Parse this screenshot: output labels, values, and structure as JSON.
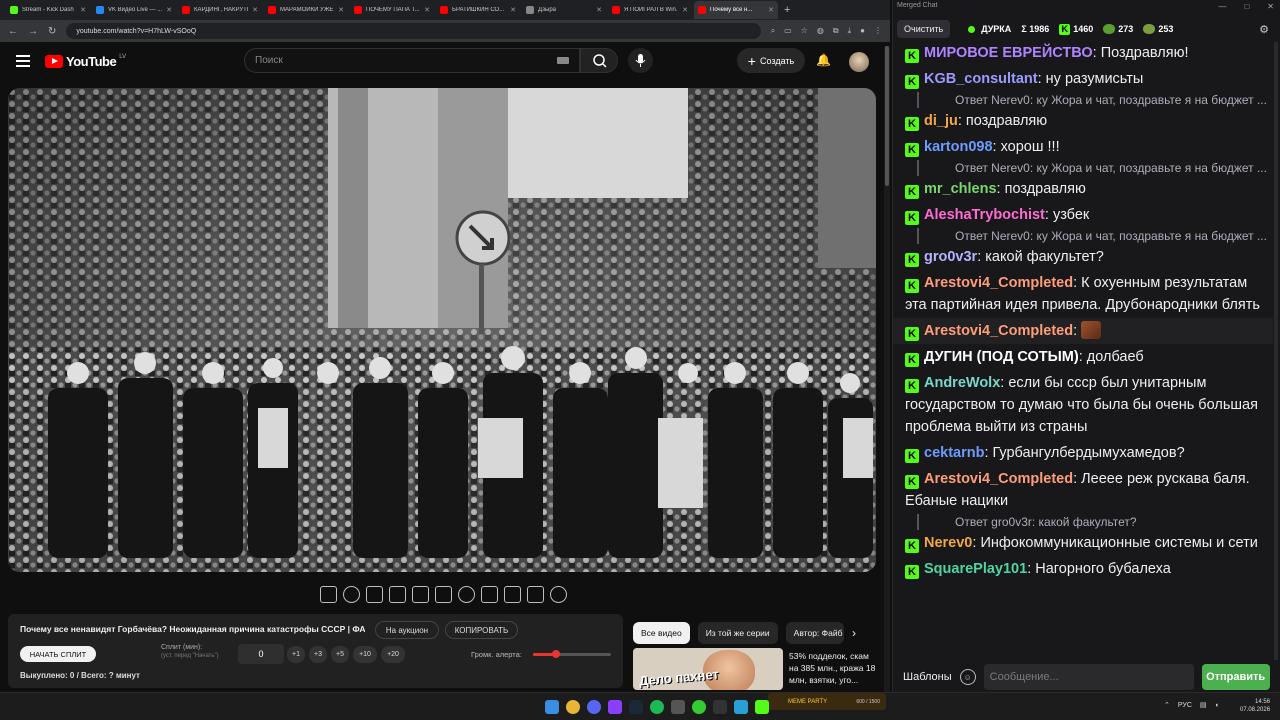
{
  "browser": {
    "tabs": [
      {
        "title": "Stream - Kick Dash",
        "color": "#53fc18"
      },
      {
        "title": "VK Видео Live — ...",
        "color": "#2787f5"
      },
      {
        "title": "КАРДИНГ, НАКРУТКА",
        "color": "#ff0000"
      },
      {
        "title": "МАРАМОЙКИ УЖЕ...",
        "color": "#ff0000"
      },
      {
        "title": "ПОЧЕМУ ПАПА Т...",
        "color": "#ff0000"
      },
      {
        "title": "БРАТИШКИН СО...",
        "color": "#ff0000"
      },
      {
        "title": "Дзыра",
        "color": "#888888"
      },
      {
        "title": "Я ПОИГРАЛ В Win...",
        "color": "#ff0000"
      },
      {
        "title": "Почему все н...",
        "color": "#ff0000"
      }
    ],
    "url": "youtube.com/watch?v=H7hLW-vSOoQ"
  },
  "youtube": {
    "logo_text": "YouTube",
    "country_code": "LV",
    "search_placeholder": "Поиск",
    "create_label": "Создать"
  },
  "info": {
    "video_title": "Почему все ненавидят Горбачёва? Неожиданная причина катастрофы СССР | ФАЙБ",
    "auction_label": "На аукцион",
    "copy_label": "КОПИРОВАТЬ",
    "start_split_label": "НАЧАТЬ СПЛИТ",
    "split_label": "Сплит (мин):",
    "split_hint": "(уст. перед \"Начать\")",
    "split_value": "0",
    "increments": [
      "+1",
      "+3",
      "+5",
      "+10",
      "+20"
    ],
    "alert_volume_label": "Громк. алерта:",
    "alert_volume": 0.3,
    "bought_text": "Выкуплено: 0 / Всего: ? минут"
  },
  "recommendations": {
    "chips": [
      "Все видео",
      "Из той же серии",
      "Автор: Файб"
    ],
    "thumb_text": "Дело пахнет",
    "video_title": "53% подделок, скам на 385 млн., кража 18 млн, взятки, уго..."
  },
  "taskbar": {
    "sticker_text": "MEME PARTY",
    "sticker_counter": "600 / 1500",
    "lang": "РУС",
    "time": "14:56",
    "date": "07.08.2026"
  },
  "chat": {
    "window_title": "Merged Chat",
    "clear_label": "Очистить",
    "channel": "ДУРКА",
    "total_label": "Σ 1986",
    "kick_count": "1460",
    "frog_count": "273",
    "other_count": "253",
    "messages": [
      {
        "user": "МИРОВОЕ ЕВРЕЙСТВО",
        "color": "#b084ff",
        "text": "Поздравляю!"
      },
      {
        "user": "KGB_consultant",
        "color": "#9b9bff",
        "text": "ну разумисьты"
      },
      {
        "reply": true,
        "user": "Nerev0",
        "text": "Ответ Nerev0: ку Жора и чат, поздравьте я на бюджет ..."
      },
      {
        "user": "di_ju",
        "color": "#f4a742",
        "text": "поздравляю"
      },
      {
        "user": "karton098",
        "color": "#6d9bff",
        "text": "хорош !!!"
      },
      {
        "reply": true,
        "user": "Nerev0",
        "text": "Ответ Nerev0: ку Жора и чат, поздравьте я на бюджет ..."
      },
      {
        "user": "mr_chlens",
        "color": "#7ad66d",
        "text": "поздравляю"
      },
      {
        "user": "AleshaTrybochist",
        "color": "#ff6ad5",
        "text": "узбек"
      },
      {
        "reply": true,
        "user": "Nerev0",
        "text": "Ответ Nerev0: ку Жора и чат, поздравьте я на бюджет ..."
      },
      {
        "user": "gro0v3r",
        "color": "#b3b3ff",
        "text": "какой факультет?"
      },
      {
        "user": "Arestovi4_Completed",
        "color": "#ff9d7a",
        "text": "К охуенным результатам эта партийная идея привела. Друбонародники блять"
      },
      {
        "user": "Arestovi4_Completed",
        "color": "#ff9d7a",
        "text": "",
        "emote": true
      },
      {
        "user": "ДУГИН (ПОД СОТЫМ)",
        "color": "#ffffff",
        "text": "долбаеб"
      },
      {
        "user": "AndreWolx",
        "color": "#7ad6c9",
        "text": "если бы ссср был унитарным государством то думаю что была бы очень большая проблема выйти из страны"
      },
      {
        "user": "cektarnb",
        "color": "#6d9bff",
        "text": "Гурбангулбердымухамедов?"
      },
      {
        "user": "Arestovi4_Completed",
        "color": "#ff9d7a",
        "text": "Лееее реж рускава баля. Ебаные нацики"
      },
      {
        "reply": true,
        "user": "gro0v3r",
        "text": "Ответ gro0v3r: какой факультет?"
      },
      {
        "user": "Nerev0",
        "color": "#f4a742",
        "text": "Инфокоммуникационные системы и сети"
      },
      {
        "user": "SquarePlay101",
        "color": "#4fd6a0",
        "text": "Нагорного бубалеха"
      }
    ],
    "templates_label": "Шаблоны",
    "input_placeholder": "Сообщение...",
    "send_label": "Отправить"
  }
}
